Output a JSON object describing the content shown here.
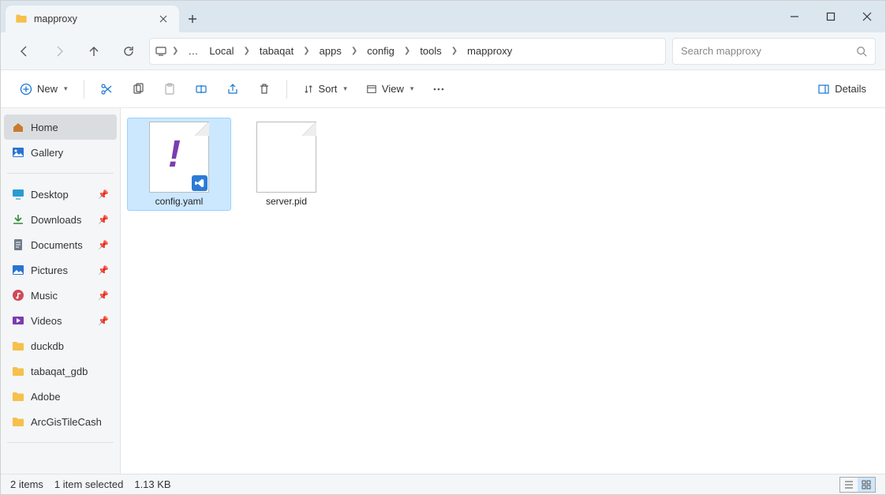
{
  "tab": {
    "title": "mapproxy"
  },
  "breadcrumb": {
    "items": [
      "Local",
      "tabaqat",
      "apps",
      "config",
      "tools",
      "mapproxy"
    ]
  },
  "search": {
    "placeholder": "Search mapproxy"
  },
  "toolbar": {
    "new_label": "New",
    "sort_label": "Sort",
    "view_label": "View",
    "details_label": "Details"
  },
  "sidebar": {
    "top": [
      {
        "label": "Home"
      },
      {
        "label": "Gallery"
      }
    ],
    "quick": [
      {
        "label": "Desktop",
        "pinned": true
      },
      {
        "label": "Downloads",
        "pinned": true
      },
      {
        "label": "Documents",
        "pinned": true
      },
      {
        "label": "Pictures",
        "pinned": true
      },
      {
        "label": "Music",
        "pinned": true
      },
      {
        "label": "Videos",
        "pinned": true
      },
      {
        "label": "duckdb",
        "pinned": false
      },
      {
        "label": "tabaqat_gdb",
        "pinned": false
      },
      {
        "label": "Adobe",
        "pinned": false
      },
      {
        "label": "ArcGisTileCash",
        "pinned": false
      }
    ]
  },
  "files": [
    {
      "name": "config.yaml",
      "selected": true,
      "kind": "yaml"
    },
    {
      "name": "server.pid",
      "selected": false,
      "kind": "generic"
    }
  ],
  "status": {
    "count": "2 items",
    "selection": "1 item selected",
    "size": "1.13 KB"
  }
}
